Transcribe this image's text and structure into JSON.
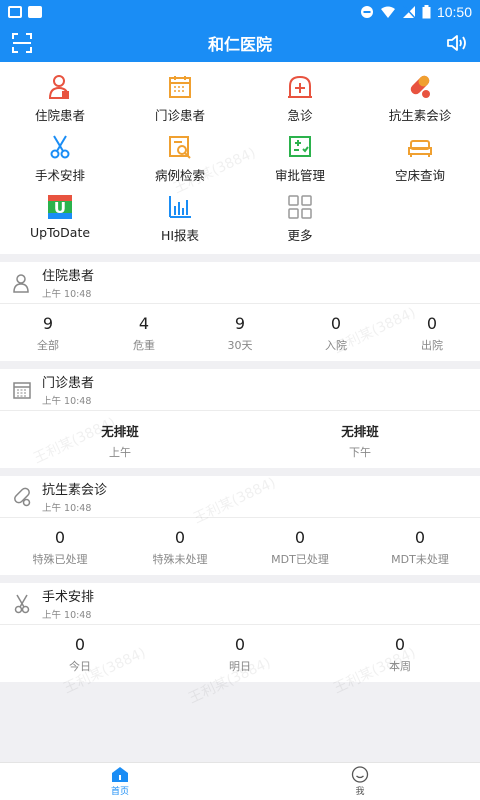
{
  "status": {
    "time": "10:50"
  },
  "header": {
    "title": "和仁医院"
  },
  "grid": {
    "items": [
      {
        "label": "住院患者"
      },
      {
        "label": "门诊患者"
      },
      {
        "label": "急诊"
      },
      {
        "label": "抗生素会诊"
      },
      {
        "label": "手术安排"
      },
      {
        "label": "病例检索"
      },
      {
        "label": "审批管理"
      },
      {
        "label": "空床查询"
      },
      {
        "label": "UpToDate"
      },
      {
        "label": "HI报表"
      },
      {
        "label": "更多"
      }
    ]
  },
  "inpatient": {
    "title": "住院患者",
    "time": "上午 10:48",
    "stats": [
      {
        "v": "9",
        "l": "全部"
      },
      {
        "v": "4",
        "l": "危重"
      },
      {
        "v": "9",
        "l": "30天"
      },
      {
        "v": "0",
        "l": "入院"
      },
      {
        "v": "0",
        "l": "出院"
      }
    ]
  },
  "outpatient": {
    "title": "门诊患者",
    "time": "上午 10:48",
    "stats": [
      {
        "v": "无排班",
        "l": "上午"
      },
      {
        "v": "无排班",
        "l": "下午"
      }
    ]
  },
  "antibiotic": {
    "title": "抗生素会诊",
    "time": "上午 10:48",
    "stats": [
      {
        "v": "0",
        "l": "特殊已处理"
      },
      {
        "v": "0",
        "l": "特殊未处理"
      },
      {
        "v": "0",
        "l": "MDT已处理"
      },
      {
        "v": "0",
        "l": "MDT未处理"
      }
    ]
  },
  "surgery": {
    "title": "手术安排",
    "time": "上午 10:48",
    "stats": [
      {
        "v": "0",
        "l": "今日"
      },
      {
        "v": "0",
        "l": "明日"
      },
      {
        "v": "0",
        "l": "本周"
      }
    ]
  },
  "tabbar": {
    "home": "首页",
    "me": "我"
  },
  "watermark": "王利某(3884)",
  "colors": {
    "primary": "#1a8df5",
    "red": "#e8533f",
    "orange": "#f0a030",
    "green": "#2bb24c"
  }
}
